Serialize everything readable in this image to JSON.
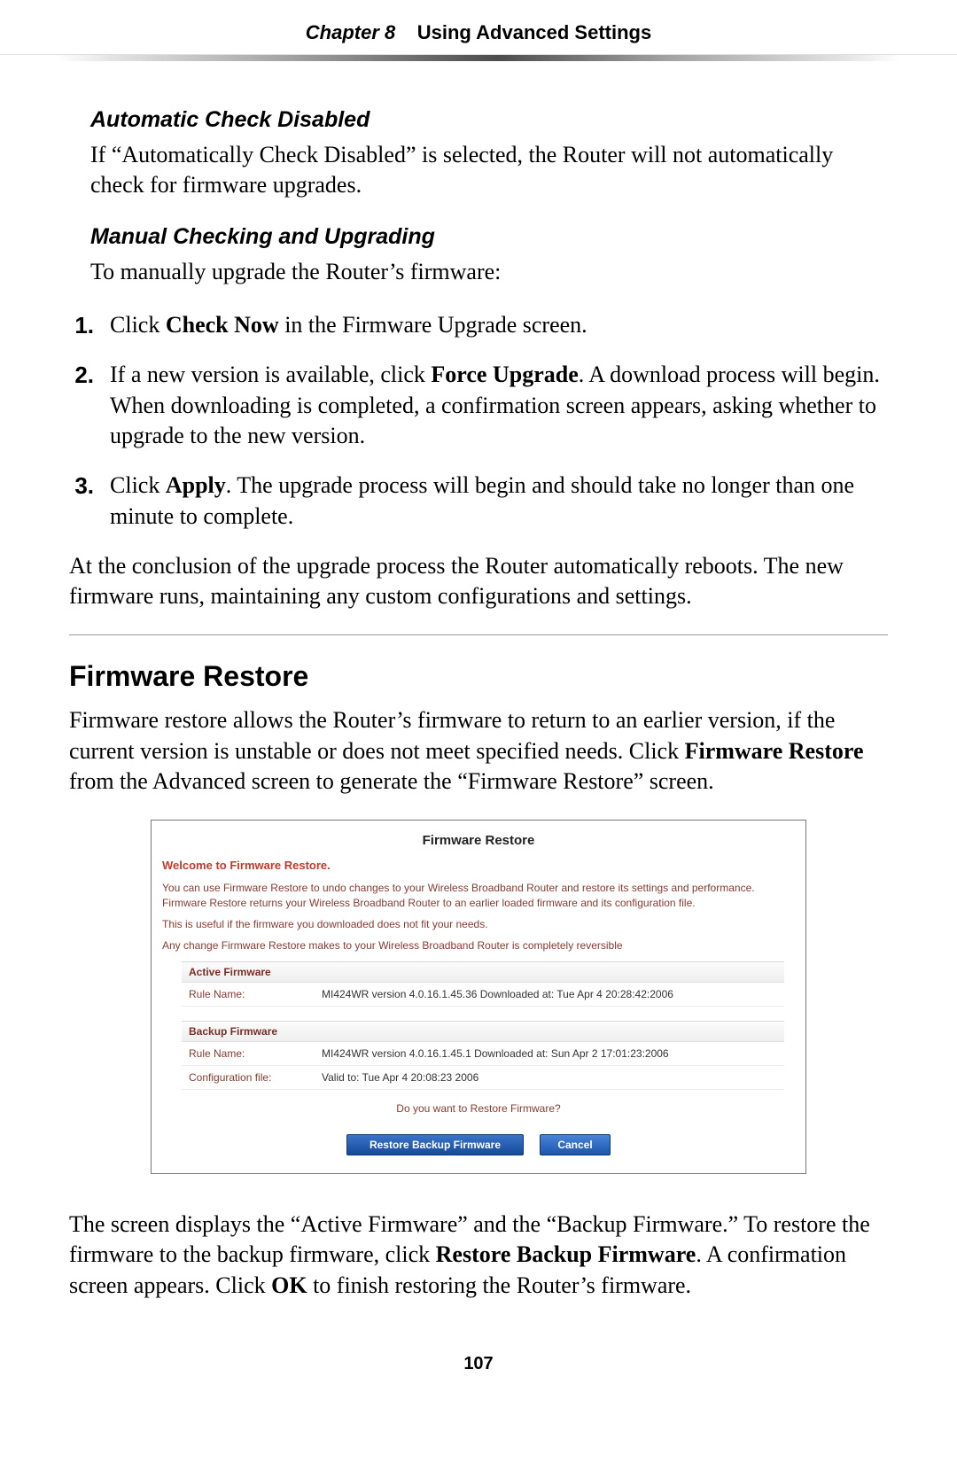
{
  "header": {
    "chapter_label": "Chapter 8",
    "chapter_title": "Using Advanced Settings"
  },
  "section_auto": {
    "heading": "Automatic Check Disabled",
    "body": "If “Automatically Check Disabled” is selected, the Router will not automatically check for firmware upgrades."
  },
  "section_manual": {
    "heading": "Manual Checking and Upgrading",
    "intro": "To manually upgrade the Router’s firmware:",
    "steps": [
      {
        "num": "1.",
        "pre": "Click ",
        "bold": "Check Now",
        "post": " in the Firmware Upgrade screen."
      },
      {
        "num": "2.",
        "pre": "If a new version is available, click ",
        "bold": "Force Upgrade",
        "post": ". A download process will begin. When downloading is completed, a confirmation screen appears, asking whether to upgrade to the new version."
      },
      {
        "num": "3.",
        "pre": "Click ",
        "bold": "Apply",
        "post": ". The upgrade process will begin and should take no longer than one minute to complete."
      }
    ],
    "outro": "At the conclusion of the upgrade process the Router automatically reboots. The new firmware runs, maintaining any custom configurations and settings."
  },
  "section_restore": {
    "heading": "Firmware Restore",
    "intro_pre": "Firmware restore allows the Router’s firmware to return to an earlier version, if the current version is unstable or does not meet specified needs. Click ",
    "intro_bold": "Firmware Restore",
    "intro_post": " from the Advanced screen to generate the “Firmware Restore” screen.",
    "outro_a": "The screen displays the “Active Firmware” and the “Backup Firmware.” To restore the firmware to the backup firmware, click ",
    "outro_bold1": "Restore Backup Firmware",
    "outro_b": ". A confirmation screen appears. Click ",
    "outro_bold2": "OK",
    "outro_c": " to finish restoring the Router’s firmware."
  },
  "shot": {
    "title": "Firmware Restore",
    "welcome": "Welcome to Firmware Restore.",
    "p1": "You can use Firmware Restore to undo changes to your Wireless Broadband Router and restore its settings and performance. Firmware Restore returns your Wireless Broadband Router to an earlier loaded firmware and its configuration file.",
    "p2": "This is useful if the firmware you downloaded does not fit your needs.",
    "p3": "Any change Firmware Restore makes to your Wireless Broadband Router is completely reversible",
    "active": {
      "head": "Active Firmware",
      "rule_label": "Rule Name:",
      "rule_value": "MI424WR version 4.0.16.1.45.36 Downloaded at: Tue Apr 4 20:28:42:2006"
    },
    "backup": {
      "head": "Backup Firmware",
      "rule_label": "Rule Name:",
      "rule_value": "MI424WR version 4.0.16.1.45.1 Downloaded at: Sun Apr 2 17:01:23:2006",
      "cfg_label": "Configuration file:",
      "cfg_value": "Valid to: Tue Apr 4 20:08:23 2006"
    },
    "prompt": "Do you want to Restore Firmware?",
    "btn_primary": "Restore Backup Firmware",
    "btn_cancel": "Cancel"
  },
  "page_number": "107"
}
